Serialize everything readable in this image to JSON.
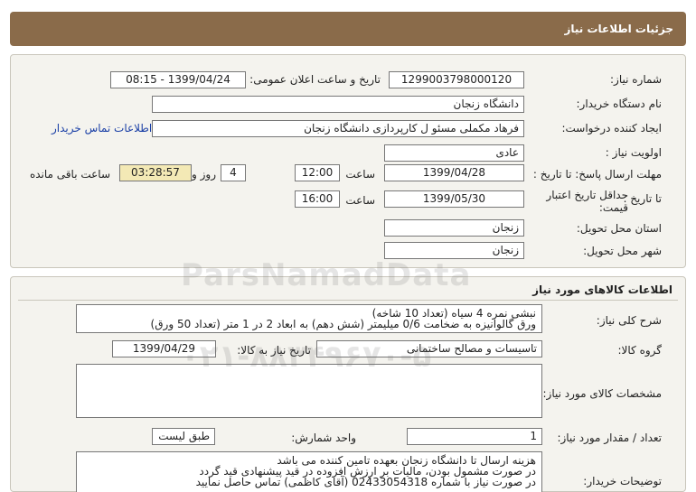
{
  "header": {
    "title": "جزئیات اطلاعات نیاز"
  },
  "details": {
    "need_number_label": "شماره نیاز:",
    "need_number": "1299003798000120",
    "announce_label": "تاریخ و ساعت اعلان عمومی:",
    "announce_value": "1399/04/24 - 08:15",
    "buyer_org_label": "نام دستگاه خریدار:",
    "buyer_org": "دانشگاه زنجان",
    "requester_label": "ایجاد کننده درخواست:",
    "requester": "فرهاد مکملی مسئو ل کارپردازی دانشگاه زنجان",
    "contact_link": "اطلاعات تماس خریدار",
    "priority_label": "اولویت نیاز :",
    "priority": "عادی",
    "deadline_label": "مهلت ارسال پاسخ: تا تاریخ :",
    "deadline_date": "1399/04/28",
    "time_label": "ساعت",
    "deadline_time": "12:00",
    "days_value": "4",
    "days_label": "روز و",
    "remaining_time": "03:28:57",
    "remaining_label": "ساعت باقی مانده",
    "validity_label": "حداقل تاریخ اعتبار قیمت:",
    "validity_to_label": "تا تاریخ :",
    "validity_date": "1399/05/30",
    "validity_time_label": "ساعت",
    "validity_time": "16:00",
    "province_label": "استان محل تحویل:",
    "province": "زنجان",
    "city_label": "شهر محل تحویل:",
    "city": "زنجان"
  },
  "goods": {
    "section_title": "اطلاعات کالاهای مورد نیاز",
    "summary_label": "شرح کلی نیاز:",
    "summary_line1": "نبشی نمره 4 سیاه (تعداد 10 شاخه)",
    "summary_line2": "ورق گالوانیزه به ضخامت 0/6 میلیمتر (شش دهم) به ابعاد 2 در 1 متر (تعداد 50 ورق)",
    "group_label": "گروه کالا:",
    "group_value": "تاسیسات و مصالح ساختمانی",
    "need_date_label": "تاریخ نیاز به کالا:",
    "need_date": "1399/04/29",
    "specs_label": "مشخصات کالای مورد نیاز:",
    "specs_value": "",
    "qty_label": "تعداد / مقدار مورد نیاز:",
    "qty_value": "1",
    "unit_label": "واحد شمارش:",
    "unit_value": "طبق لیست",
    "buyer_notes_label": "توضیحات خریدار:",
    "notes_line1": "هزینه ارسال تا دانشگاه زنجان بعهده تامین کننده می باشد",
    "notes_line2": "در صورت مشمول بودن، مالیات بر ارزش افزوده در قید پیشنهادی قید گردد",
    "notes_line3": "در صورت نیاز با شماره 02433054318 (آقای کاظمی) تماس حاصل نمایید"
  },
  "watermark": {
    "line1": "ParsNamadData",
    "line2": "۰۲۱-۸۸۳۴۹۶۷۰-۵"
  }
}
